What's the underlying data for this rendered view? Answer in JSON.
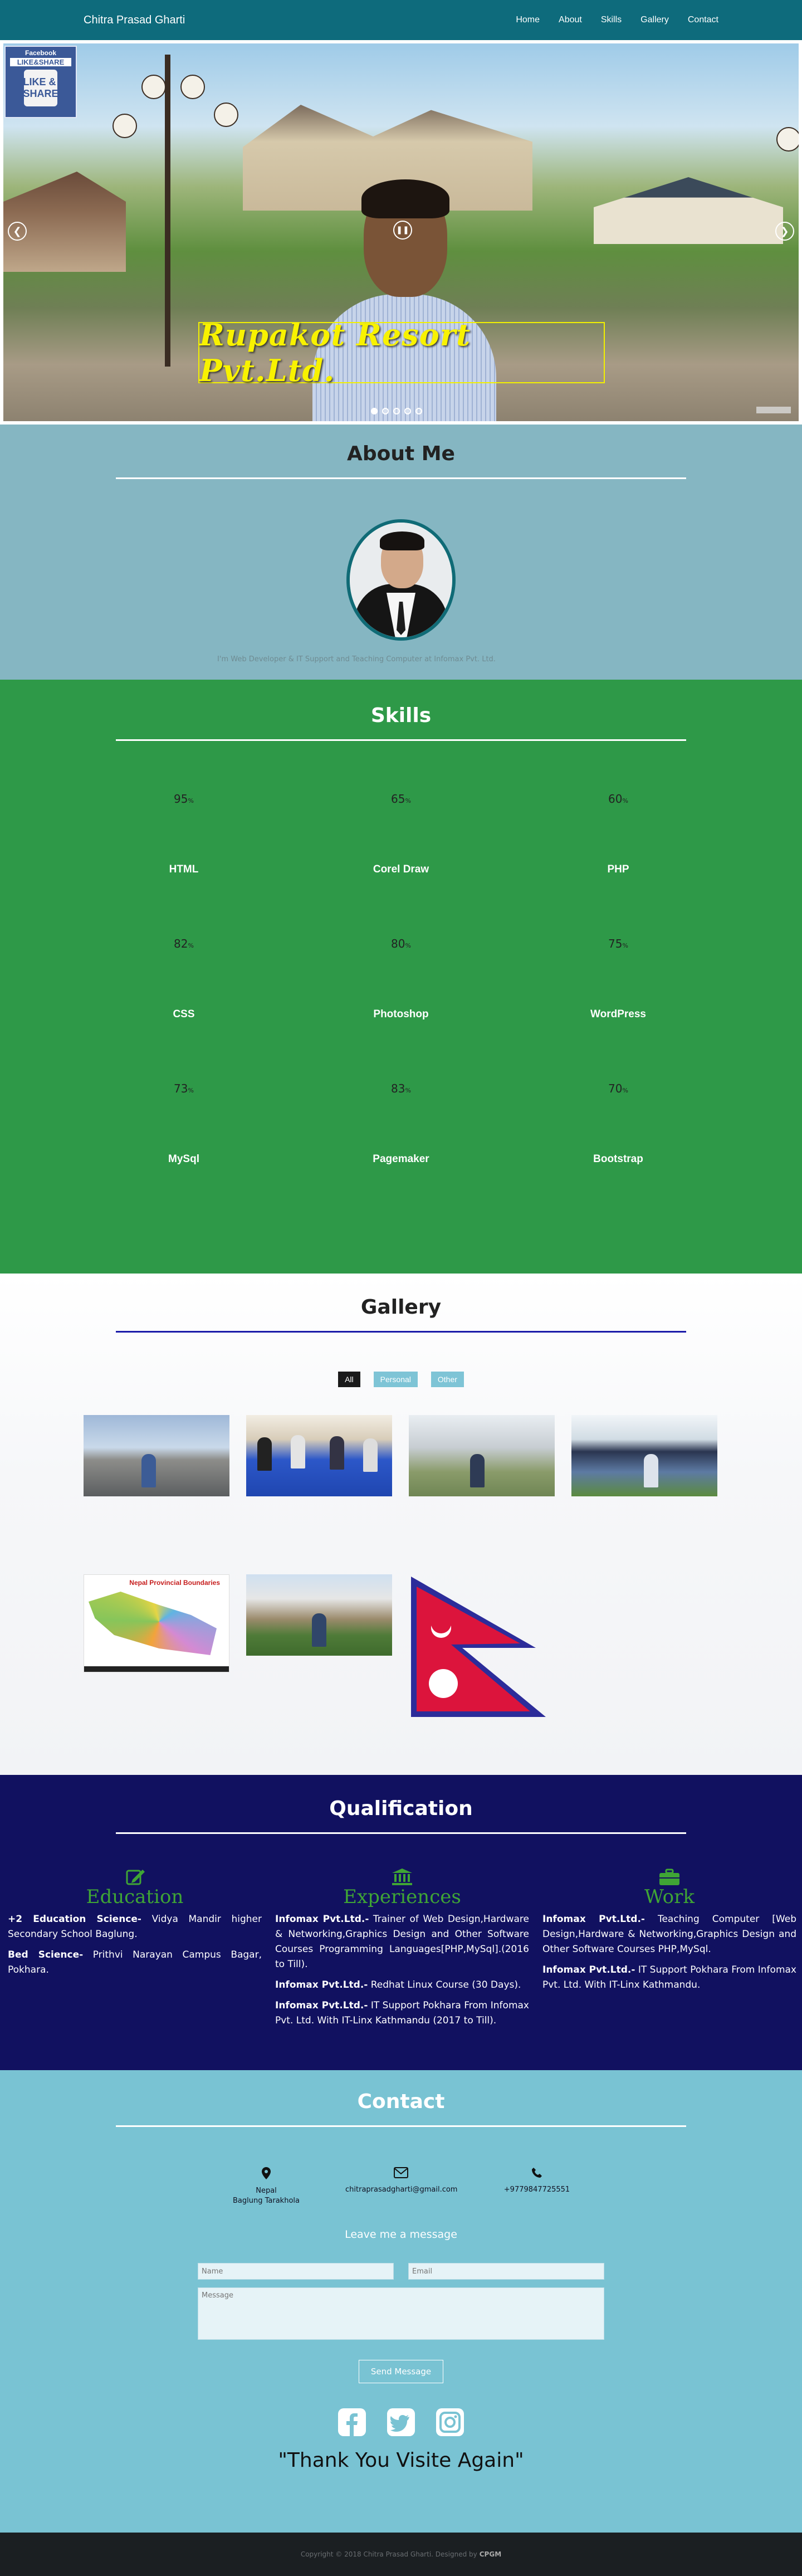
{
  "navbar": {
    "brand": "Chitra Prasad Gharti",
    "links": [
      "Home",
      "About",
      "Skills",
      "Gallery",
      "Contact"
    ]
  },
  "hero": {
    "title": "Rupakot Resort Pvt.Ltd.",
    "prev_icon": "chevron-left-icon",
    "next_icon": "chevron-right-icon",
    "play_icon": "pause-icon",
    "badge": {
      "line1": "Facebook",
      "line2": "LIKE&SHARE",
      "hand": "LIKE & SHARE"
    }
  },
  "about": {
    "title": "About Me",
    "text": "I'm Web Developer & IT Support and Teaching Computer at Infomax Pvt. Ltd."
  },
  "skills": {
    "title": "Skills",
    "items": [
      {
        "pct": "95",
        "name": "HTML"
      },
      {
        "pct": "65",
        "name": "Corel Draw"
      },
      {
        "pct": "60",
        "name": "PHP"
      },
      {
        "pct": "82",
        "name": "CSS"
      },
      {
        "pct": "80",
        "name": "Photoshop"
      },
      {
        "pct": "75",
        "name": "WordPress"
      },
      {
        "pct": "73",
        "name": "MySql"
      },
      {
        "pct": "83",
        "name": "Pagemaker"
      },
      {
        "pct": "70",
        "name": "Bootstrap"
      }
    ],
    "pct_suffix": "%"
  },
  "gallery": {
    "title": "Gallery",
    "filters": [
      "All",
      "Personal",
      "Other"
    ],
    "map_title": "Nepal Provincial Boundaries"
  },
  "qualification": {
    "title": "Qualification",
    "education": {
      "heading": "Education",
      "icon": "edit-icon",
      "entries": [
        {
          "label": "+2 Education Science-",
          "text": " Vidya Mandir higher Secondary School Baglung."
        },
        {
          "label": "Bed Science-",
          "text": " Prithvi Narayan Campus Bagar, Pokhara."
        }
      ]
    },
    "experiences": {
      "heading": "Experiences",
      "icon": "bank-icon",
      "entries": [
        {
          "label": "Infomax Pvt.Ltd.-",
          "text": " Trainer of Web Design,Hardware & Networking,Graphics Design and Other Software Courses Programming Languages[PHP,MySql].(2016 to Till)."
        },
        {
          "label": "Infomax Pvt.Ltd.-",
          "text": " Redhat Linux Course (30 Days)."
        },
        {
          "label": "Infomax Pvt.Ltd.-",
          "text": " IT Support Pokhara From Infomax Pvt. Ltd. With IT-Linx Kathmandu (2017 to Till)."
        }
      ]
    },
    "work": {
      "heading": "Work",
      "icon": "briefcase-icon",
      "entries": [
        {
          "label": "Infomax Pvt.Ltd.-",
          "text": " Teaching Computer [Web Design,Hardware & Networking,Graphics Design and Other Software Courses PHP,MySql."
        },
        {
          "label": "Infomax Pvt.Ltd.-",
          "text": " IT Support Pokhara From Infomax Pvt. Ltd. With IT-Linx Kathmandu."
        }
      ]
    }
  },
  "contact": {
    "title": "Contact",
    "address_line1": "Nepal",
    "address_line2": "Baglung Tarakhola",
    "email": "chitraprasadgharti@gmail.com",
    "phone": "+9779847725551",
    "leave_message": "Leave me a message",
    "name_placeholder": "Name",
    "email_placeholder": "Email",
    "message_placeholder": "Message",
    "send_label": "Send Message",
    "thanks": "\"Thank You Visite Again\""
  },
  "footer": {
    "text": "Copyright © 2018 Chitra Prasad Gharti. Designed by",
    "designer": "CPGM"
  },
  "colors": {
    "navbar": "#0e6b7c",
    "about_bg": "#85b6c2",
    "skills_bg": "#2e9948",
    "qual_bg": "#111160",
    "contact_bg": "#79c3d3",
    "qual_heading": "#3fa535",
    "footer_bg": "#1b1f22"
  }
}
